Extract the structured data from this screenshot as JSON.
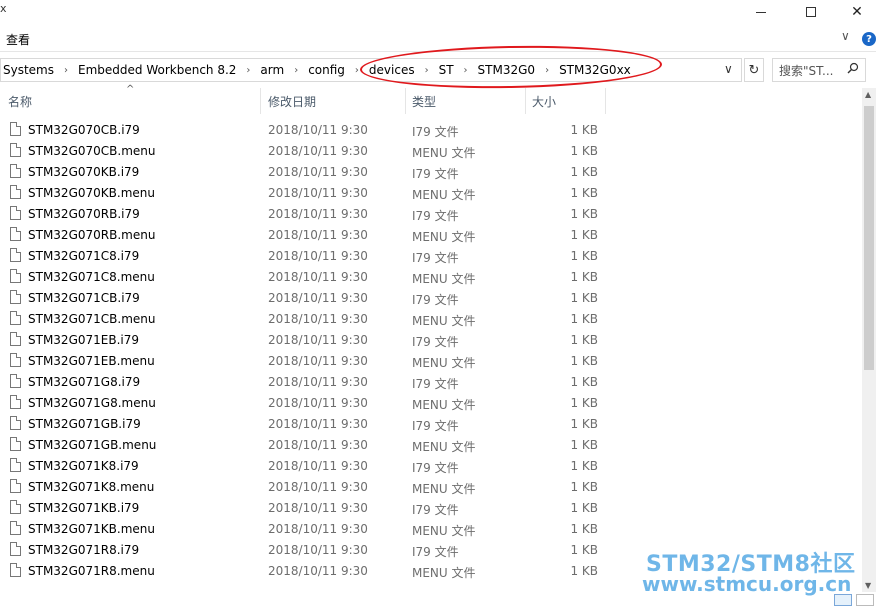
{
  "window": {
    "title_fragment": "x",
    "controls": {
      "minimize": "—",
      "maximize": "☐",
      "close": "✕"
    }
  },
  "ribbon": {
    "tab_view": "查看",
    "expand": "∨",
    "help": "?"
  },
  "address": {
    "crumbs": [
      "Systems",
      "Embedded Workbench 8.2",
      "arm",
      "config",
      "devices",
      "ST",
      "STM32G0",
      "STM32G0xx"
    ],
    "separator": "›",
    "dropdown": "∨",
    "refresh": "↻"
  },
  "search": {
    "placeholder": "搜索\"ST...",
    "icon": "search-icon"
  },
  "columns": {
    "name": "名称",
    "date": "修改日期",
    "type": "类型",
    "size": "大小",
    "sort": "^"
  },
  "files": [
    {
      "name": "STM32G070CB.i79",
      "date": "2018/10/11 9:30",
      "type": "I79 文件",
      "size": "1 KB"
    },
    {
      "name": "STM32G070CB.menu",
      "date": "2018/10/11 9:30",
      "type": "MENU 文件",
      "size": "1 KB"
    },
    {
      "name": "STM32G070KB.i79",
      "date": "2018/10/11 9:30",
      "type": "I79 文件",
      "size": "1 KB"
    },
    {
      "name": "STM32G070KB.menu",
      "date": "2018/10/11 9:30",
      "type": "MENU 文件",
      "size": "1 KB"
    },
    {
      "name": "STM32G070RB.i79",
      "date": "2018/10/11 9:30",
      "type": "I79 文件",
      "size": "1 KB"
    },
    {
      "name": "STM32G070RB.menu",
      "date": "2018/10/11 9:30",
      "type": "MENU 文件",
      "size": "1 KB"
    },
    {
      "name": "STM32G071C8.i79",
      "date": "2018/10/11 9:30",
      "type": "I79 文件",
      "size": "1 KB"
    },
    {
      "name": "STM32G071C8.menu",
      "date": "2018/10/11 9:30",
      "type": "MENU 文件",
      "size": "1 KB"
    },
    {
      "name": "STM32G071CB.i79",
      "date": "2018/10/11 9:30",
      "type": "I79 文件",
      "size": "1 KB"
    },
    {
      "name": "STM32G071CB.menu",
      "date": "2018/10/11 9:30",
      "type": "MENU 文件",
      "size": "1 KB"
    },
    {
      "name": "STM32G071EB.i79",
      "date": "2018/10/11 9:30",
      "type": "I79 文件",
      "size": "1 KB"
    },
    {
      "name": "STM32G071EB.menu",
      "date": "2018/10/11 9:30",
      "type": "MENU 文件",
      "size": "1 KB"
    },
    {
      "name": "STM32G071G8.i79",
      "date": "2018/10/11 9:30",
      "type": "I79 文件",
      "size": "1 KB"
    },
    {
      "name": "STM32G071G8.menu",
      "date": "2018/10/11 9:30",
      "type": "MENU 文件",
      "size": "1 KB"
    },
    {
      "name": "STM32G071GB.i79",
      "date": "2018/10/11 9:30",
      "type": "I79 文件",
      "size": "1 KB"
    },
    {
      "name": "STM32G071GB.menu",
      "date": "2018/10/11 9:30",
      "type": "MENU 文件",
      "size": "1 KB"
    },
    {
      "name": "STM32G071K8.i79",
      "date": "2018/10/11 9:30",
      "type": "I79 文件",
      "size": "1 KB"
    },
    {
      "name": "STM32G071K8.menu",
      "date": "2018/10/11 9:30",
      "type": "MENU 文件",
      "size": "1 KB"
    },
    {
      "name": "STM32G071KB.i79",
      "date": "2018/10/11 9:30",
      "type": "I79 文件",
      "size": "1 KB"
    },
    {
      "name": "STM32G071KB.menu",
      "date": "2018/10/11 9:30",
      "type": "MENU 文件",
      "size": "1 KB"
    },
    {
      "name": "STM32G071R8.i79",
      "date": "2018/10/11 9:30",
      "type": "I79 文件",
      "size": "1 KB"
    },
    {
      "name": "STM32G071R8.menu",
      "date": "2018/10/11 9:30",
      "type": "MENU 文件",
      "size": "1 KB"
    }
  ],
  "watermark": {
    "line1": "STM32/STM8社区",
    "line2": "www.stmcu.org.cn"
  },
  "colors": {
    "annotation_red": "#e0191d",
    "watermark_blue": "#6fb6e8",
    "help_blue": "#1a67c7"
  }
}
